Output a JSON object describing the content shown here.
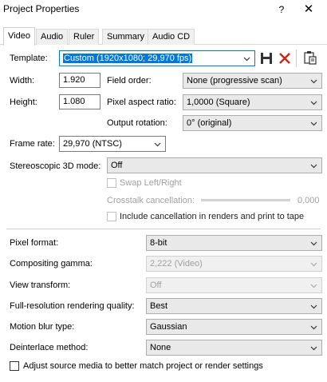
{
  "window": {
    "title": "Project Properties",
    "help_glyph": "?",
    "close_glyph": "✕"
  },
  "tabs": [
    {
      "label": "Video",
      "active": true
    },
    {
      "label": "Audio",
      "active": false
    },
    {
      "label": "Ruler",
      "active": false
    },
    {
      "label": "Summary",
      "active": false
    },
    {
      "label": "Audio CD",
      "active": false
    }
  ],
  "video": {
    "template_label": "Template:",
    "template_value": "Custom (1920x1080; 29,970 fps)",
    "width_label": "Width:",
    "width_value": "1.920",
    "height_label": "Height:",
    "height_value": "1.080",
    "field_order_label": "Field order:",
    "field_order_value": "None (progressive scan)",
    "pixel_aspect_label": "Pixel aspect ratio:",
    "pixel_aspect_value": "1,0000 (Square)",
    "output_rotation_label": "Output rotation:",
    "output_rotation_value": "0° (original)",
    "frame_rate_label": "Frame rate:",
    "frame_rate_value": "29,970 (NTSC)",
    "stereo_label": "Stereoscopic 3D mode:",
    "stereo_value": "Off",
    "swap_label": "Swap Left/Right",
    "crosstalk_label": "Crosstalk cancellation:",
    "crosstalk_value": "0,000",
    "include_cancel_label": "Include cancellation in renders and print to tape",
    "pixel_format_label": "Pixel format:",
    "pixel_format_value": "8-bit",
    "compositing_label": "Compositing gamma:",
    "compositing_value": "2,222 (Video)",
    "view_transform_label": "View transform:",
    "view_transform_value": "Off",
    "fullres_label": "Full-resolution rendering quality:",
    "fullres_value": "Best",
    "motion_blur_label": "Motion blur type:",
    "motion_blur_value": "Gaussian",
    "deinterlace_label": "Deinterlace method:",
    "deinterlace_value": "None",
    "adjust_source_label": "Adjust source media to better match project or render settings"
  },
  "icons": {
    "save": "save-icon",
    "delete": "delete-icon",
    "paste": "paste-icon"
  },
  "colors": {
    "selection": "#0078d7",
    "delete_red": "#c42b1c"
  }
}
